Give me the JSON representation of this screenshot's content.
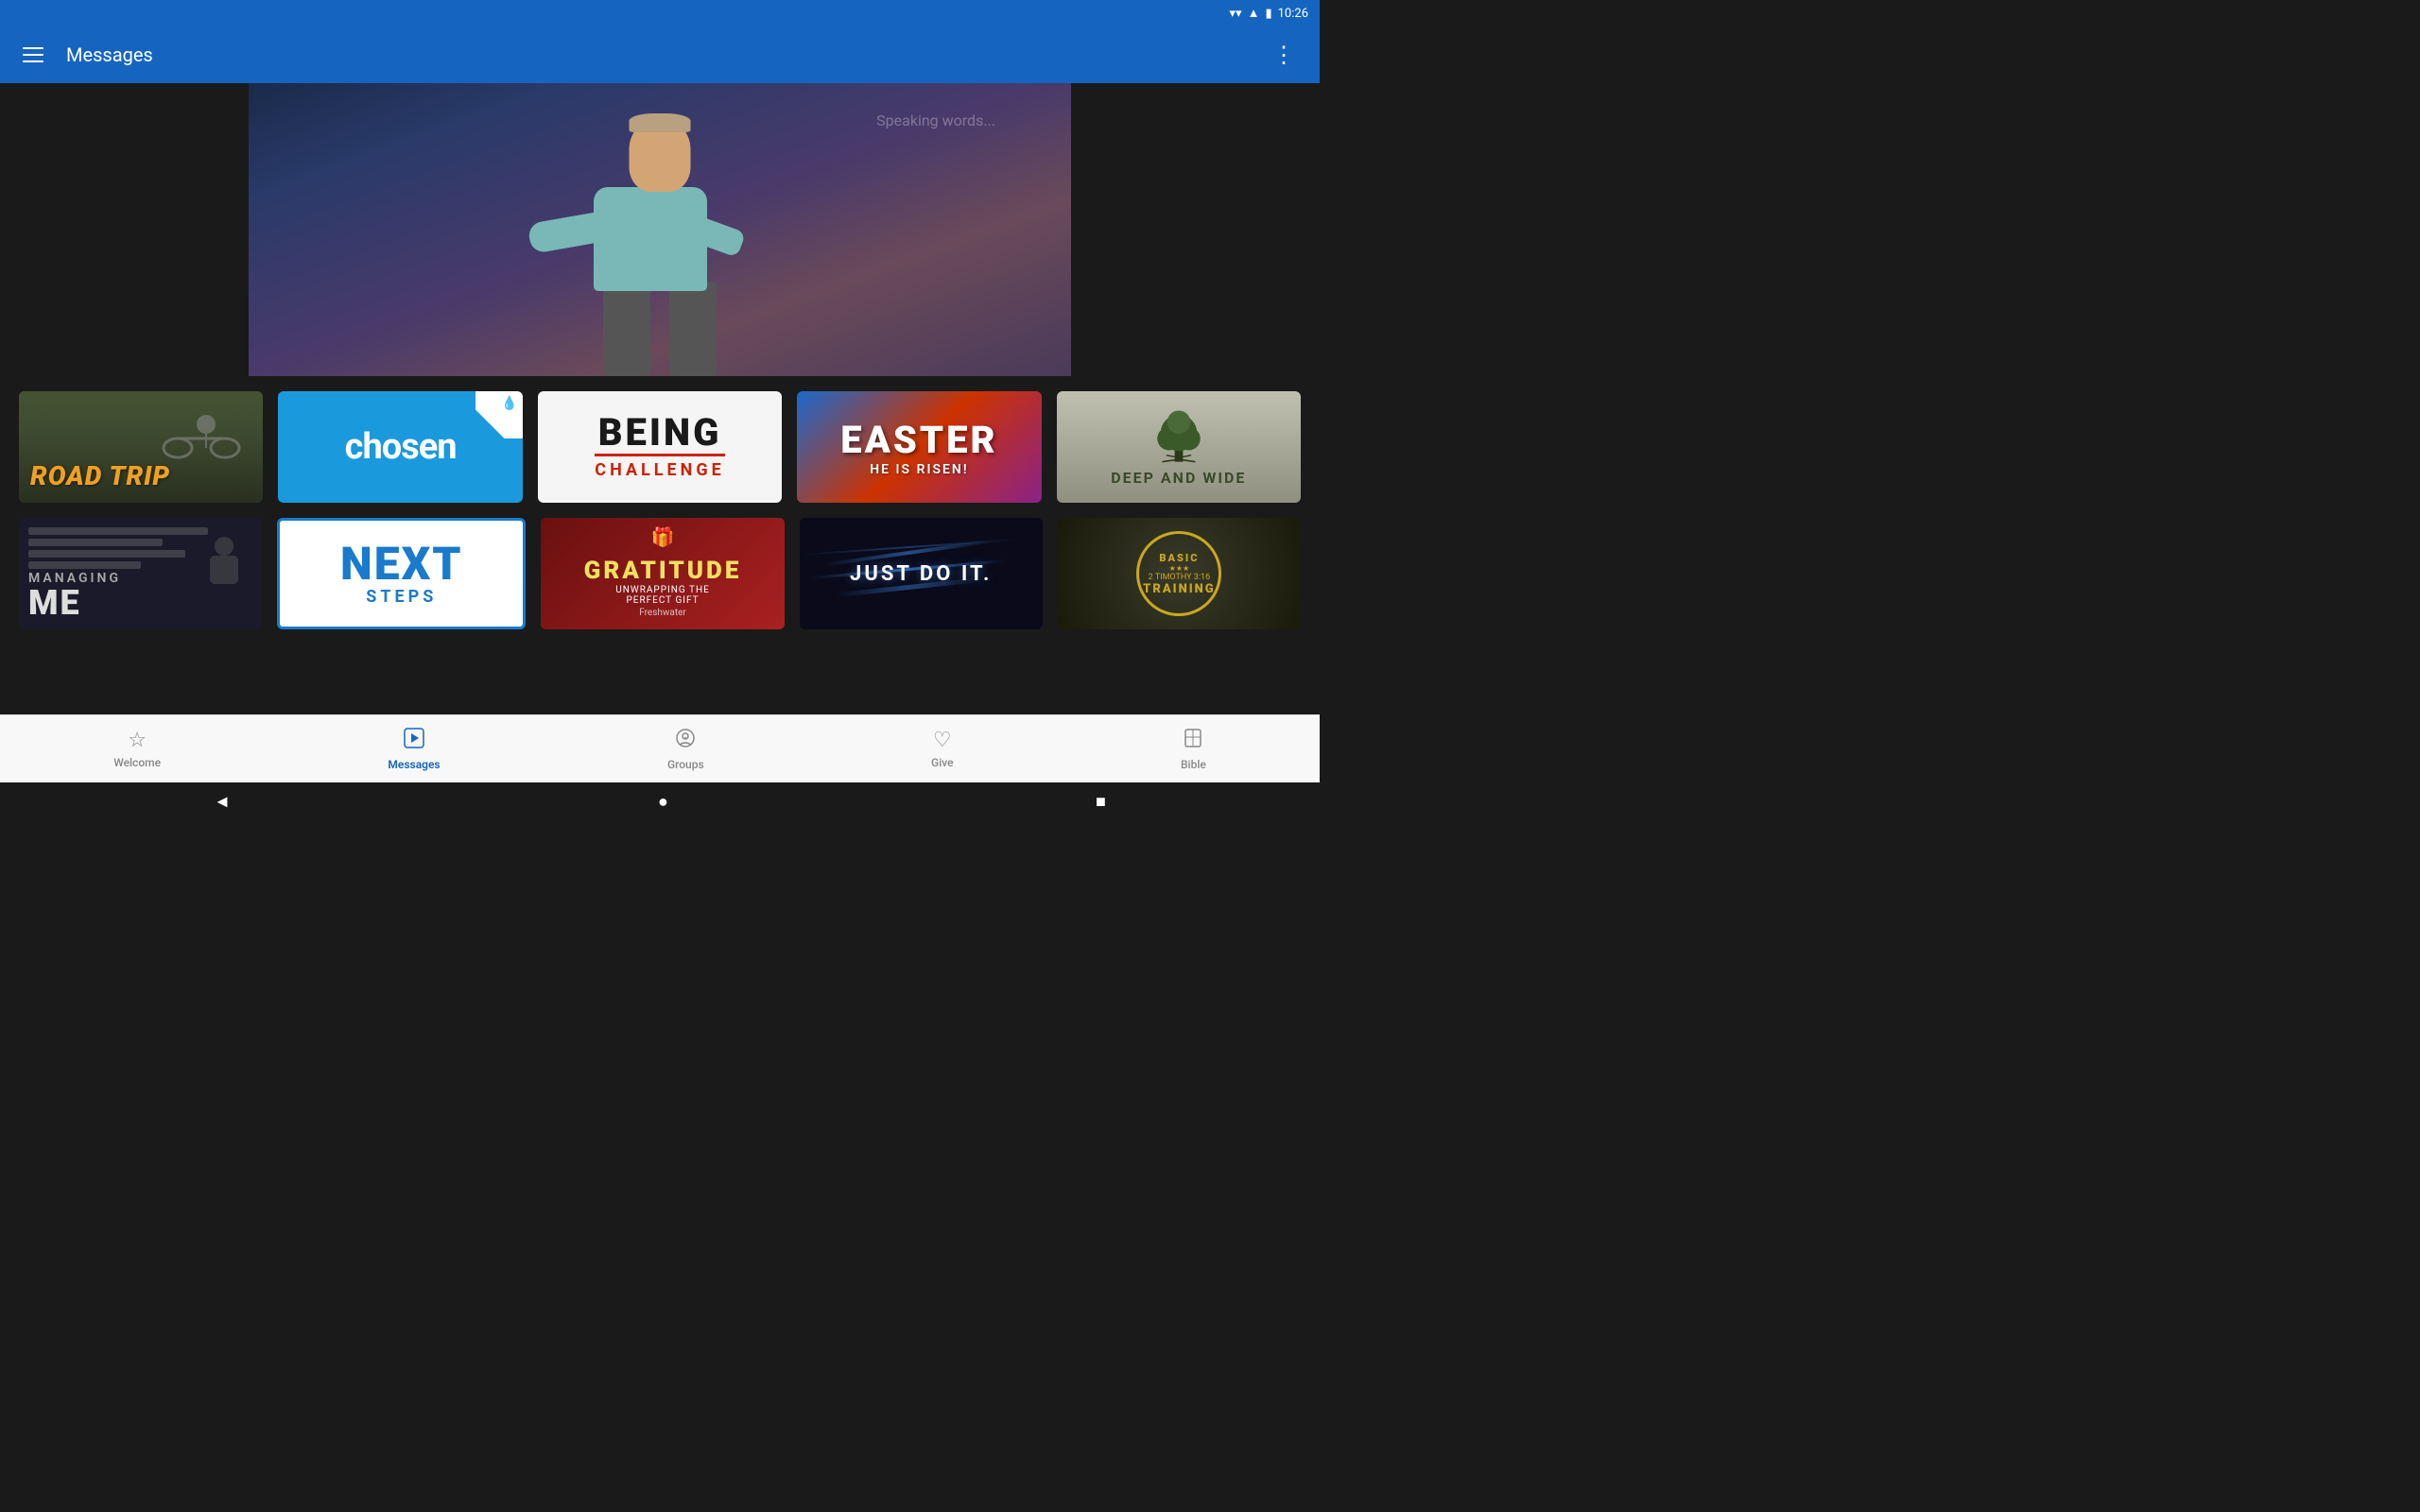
{
  "statusBar": {
    "time": "10:26",
    "wifiIcon": "wifi",
    "signalIcon": "signal",
    "batteryIcon": "battery"
  },
  "appBar": {
    "title": "Messages",
    "menuIcon": "hamburger",
    "moreIcon": "more-vertical"
  },
  "hero": {
    "altText": "Speaker pointing on stage"
  },
  "grid": {
    "row1": [
      {
        "id": "road-trip",
        "label": "RoaD TRiP",
        "type": "road-trip"
      },
      {
        "id": "chosen",
        "label": "chosen",
        "type": "chosen"
      },
      {
        "id": "being-challenge",
        "labelLine1": "BEING",
        "labelLine2": "CHALLENGE",
        "type": "being"
      },
      {
        "id": "easter",
        "labelLine1": "EASTER",
        "labelLine2": "HE IS RISEN!",
        "type": "easter"
      },
      {
        "id": "deep-wide",
        "labelLine1": "DEEP",
        "labelLine2": "AND",
        "labelLine3": "WIDE",
        "type": "deep"
      }
    ],
    "row2": [
      {
        "id": "managing-me",
        "labelLine1": "MANAGING",
        "labelLine2": "ME",
        "type": "managing"
      },
      {
        "id": "next-steps",
        "labelLine1": "NEXT",
        "labelLine2": "STEPS",
        "type": "next"
      },
      {
        "id": "gratitude",
        "labelLine1": "GRATITUDE",
        "labelLine2": "UNWRAPPING THE",
        "labelLine3": "PERFECT GIFT",
        "source": "Freshwater",
        "type": "gratitude"
      },
      {
        "id": "just-do-it",
        "label": "JUST DO IT.",
        "type": "justdoit"
      },
      {
        "id": "basic-training",
        "labelLine1": "BASIC",
        "labelLine2": "★★★",
        "labelLine3": "2 TIMOTHY 3:16",
        "labelLine4": "TRAINING",
        "type": "basic"
      }
    ]
  },
  "bottomNav": {
    "items": [
      {
        "id": "welcome",
        "label": "Welcome",
        "icon": "☆",
        "active": false
      },
      {
        "id": "messages",
        "label": "Messages",
        "icon": "▶",
        "active": true
      },
      {
        "id": "groups",
        "label": "Groups",
        "icon": "💬",
        "active": false
      },
      {
        "id": "give",
        "label": "Give",
        "icon": "♡",
        "active": false
      },
      {
        "id": "bible",
        "label": "Bible",
        "icon": "📖",
        "active": false
      }
    ]
  },
  "sysNav": {
    "backBtn": "◄",
    "homeBtn": "●",
    "recentsBtn": "■"
  }
}
